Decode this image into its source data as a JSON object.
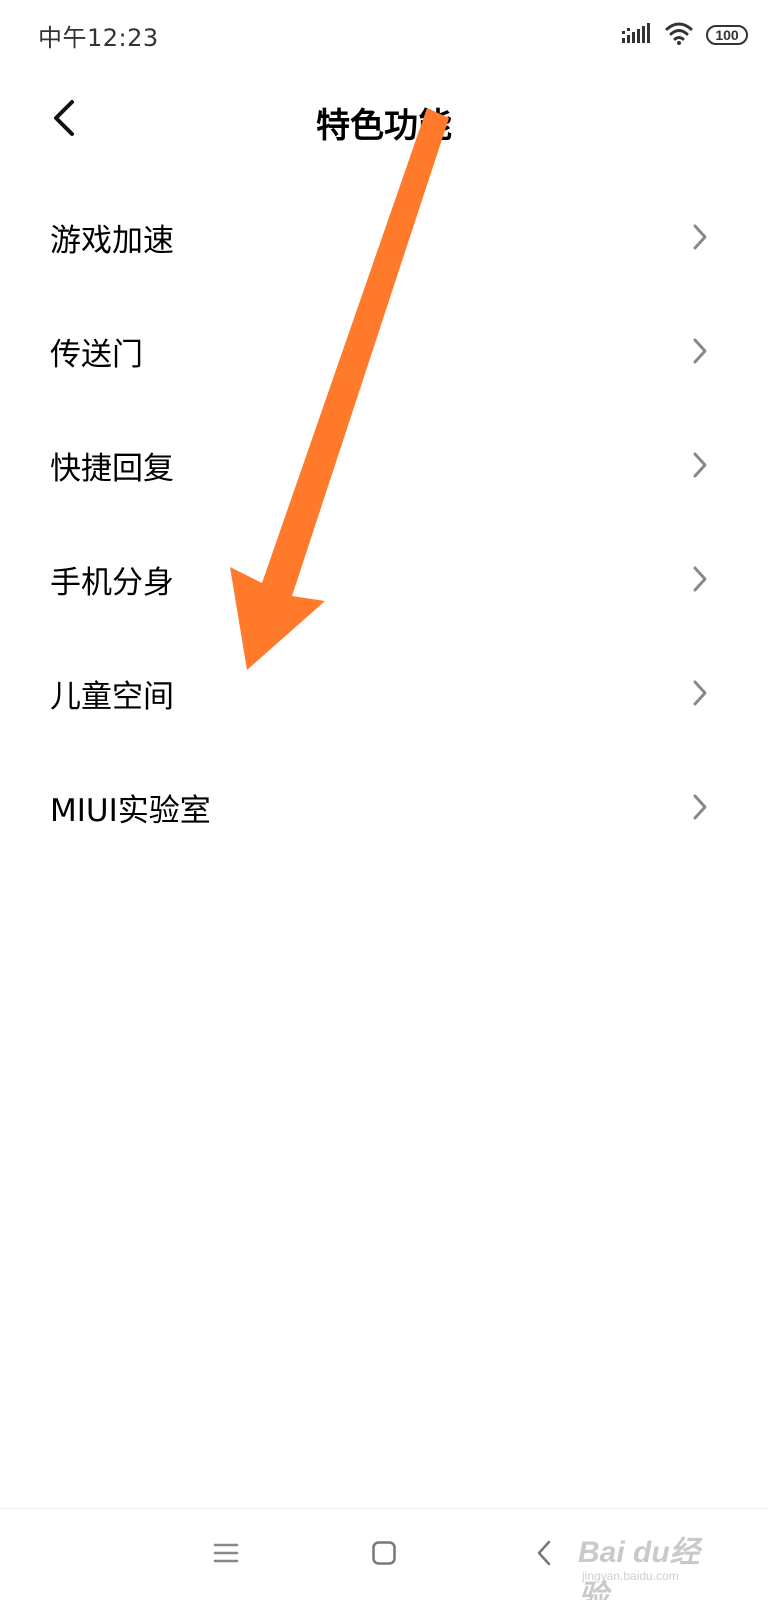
{
  "status_bar": {
    "time": "中午12:23",
    "battery": "100",
    "icons": [
      "signal-icon",
      "wifi-icon",
      "battery-icon"
    ]
  },
  "header": {
    "title": "特色功能",
    "back_icon": "back-arrow-icon"
  },
  "menu": {
    "items": [
      {
        "label": "游戏加速"
      },
      {
        "label": "传送门"
      },
      {
        "label": "快捷回复"
      },
      {
        "label": "手机分身"
      },
      {
        "label": "儿童空间"
      },
      {
        "label": "MIUI实验室"
      }
    ]
  },
  "annotation": {
    "color": "#ff7a2a",
    "icon": "annotation-arrow-icon"
  },
  "nav_bar": {
    "icons": [
      "menu-icon",
      "home-icon",
      "back-icon"
    ]
  },
  "watermark": {
    "brand": "Bai du经验",
    "url": "jingyan.baidu.com"
  }
}
